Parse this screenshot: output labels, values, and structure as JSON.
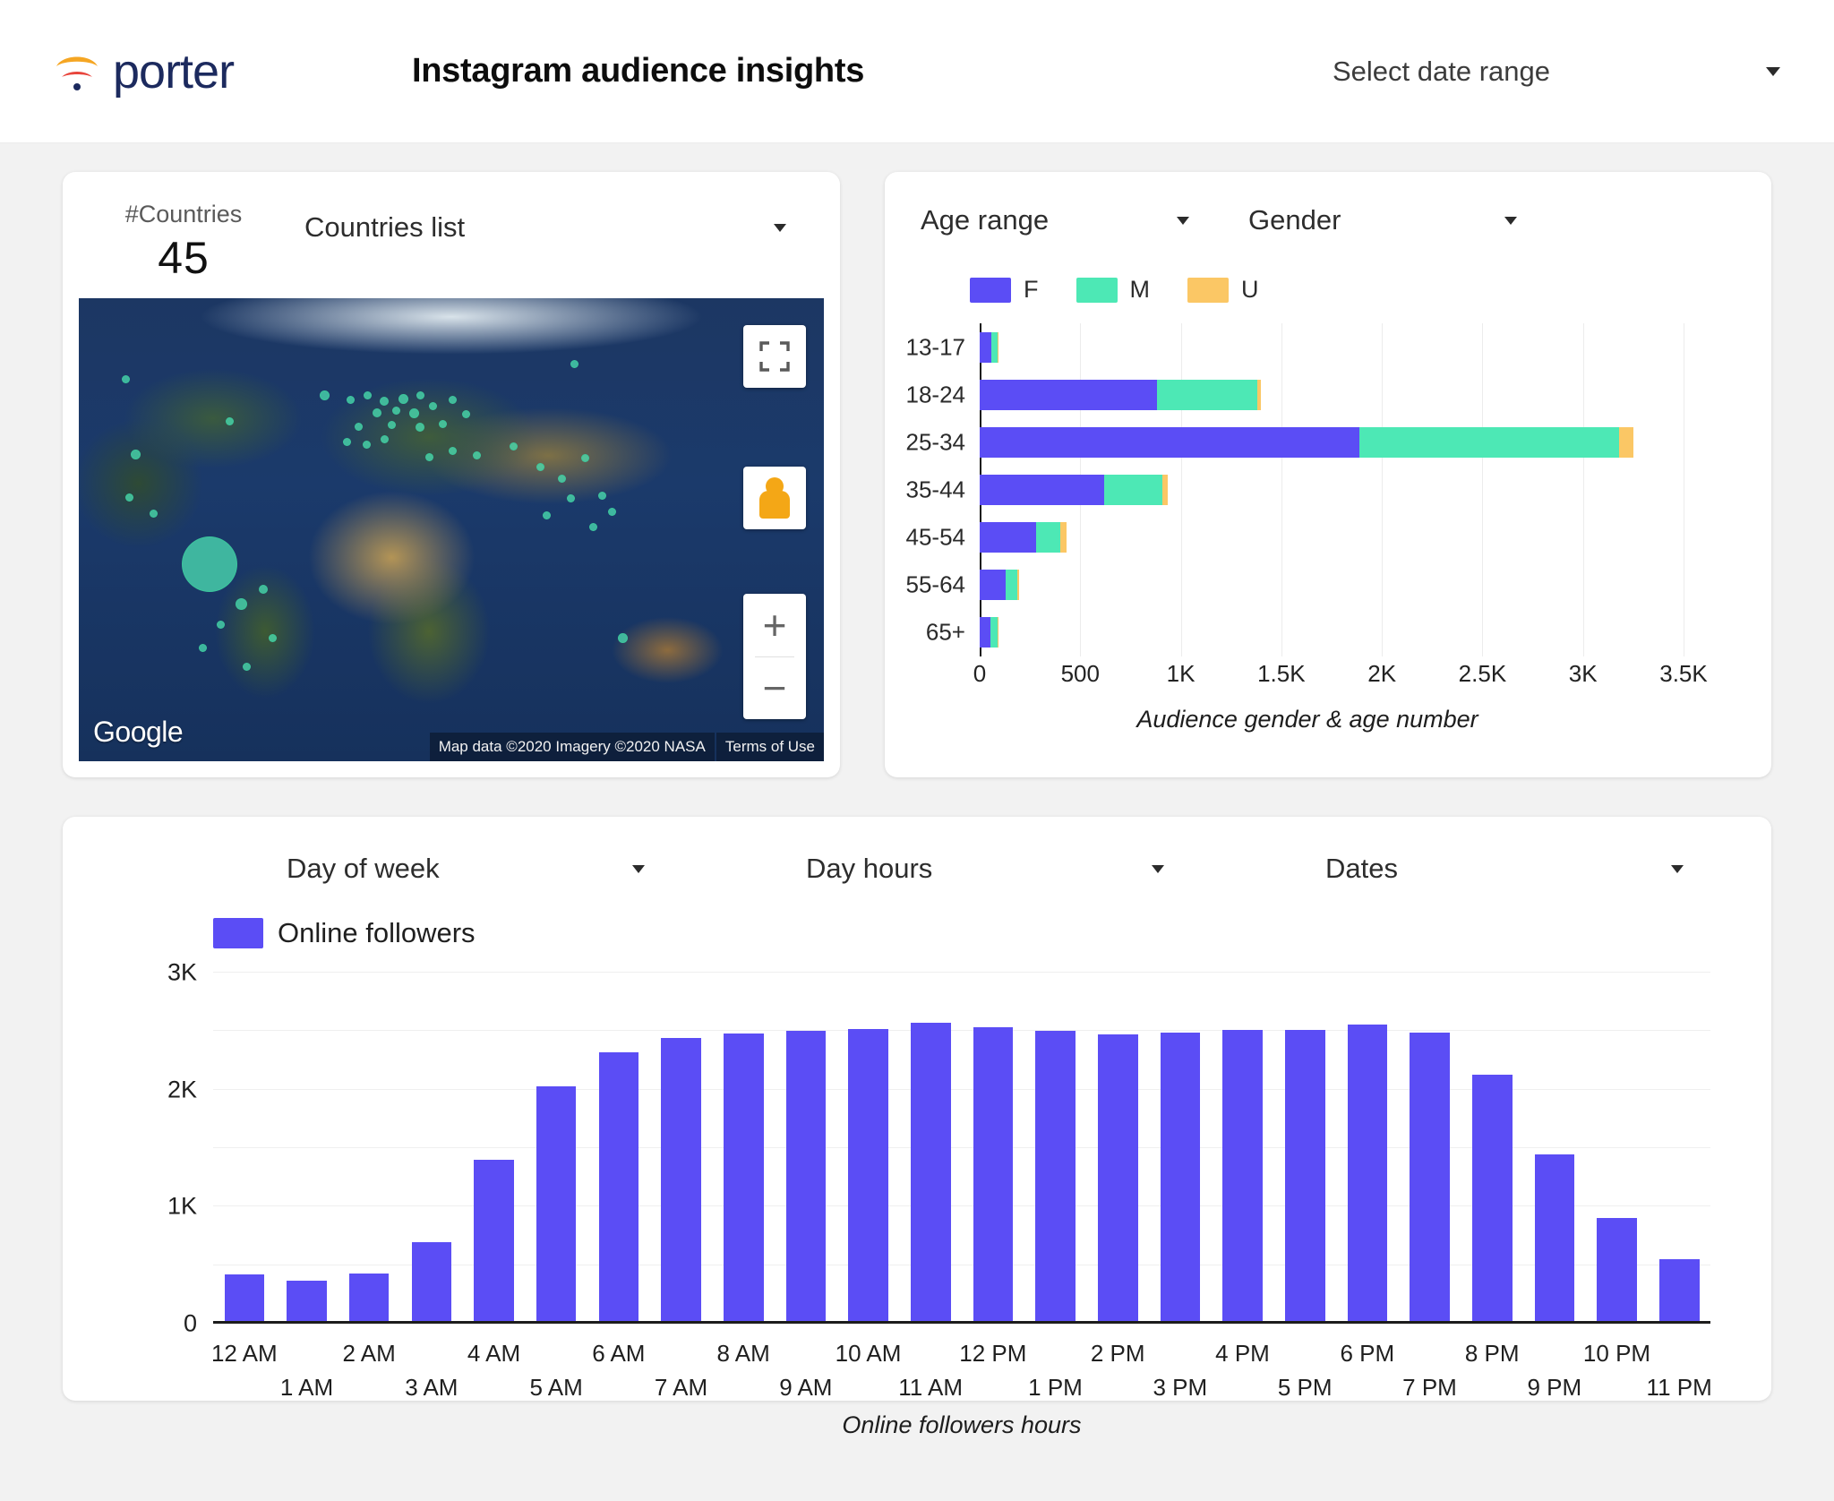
{
  "header": {
    "brand_name": "porter",
    "brand_colors": {
      "arc_top": "#F5A623",
      "arc_bottom": "#E8453C",
      "word": "#1C2A5E"
    },
    "title": "Instagram audience insights",
    "date_range_label": "Select date range"
  },
  "countries_card": {
    "kpi_label": "#Countries",
    "kpi_value": "45",
    "dropdown_label": "Countries list",
    "map": {
      "watermark": "Google",
      "attribution": "Map data ©2020 Imagery ©2020 NASA",
      "terms": "Terms of Use",
      "zoom_in": "+",
      "zoom_out": "−"
    }
  },
  "gender_card": {
    "dropdown_age_label": "Age range",
    "dropdown_gender_label": "Gender",
    "chart_data": {
      "type": "bar",
      "orientation": "horizontal",
      "stacked": true,
      "title": "",
      "xlabel": "Audience gender & age number",
      "ylabel": "",
      "categories": [
        "13-17",
        "18-24",
        "25-34",
        "35-44",
        "45-54",
        "55-64",
        "65+"
      ],
      "series": [
        {
          "name": "F",
          "color": "#5B4DF5",
          "values": [
            60,
            880,
            1890,
            620,
            280,
            130,
            55
          ]
        },
        {
          "name": "M",
          "color": "#4DE8B5",
          "values": [
            30,
            500,
            1290,
            290,
            120,
            55,
            35
          ]
        },
        {
          "name": "U",
          "color": "#FBC765",
          "values": [
            4,
            20,
            70,
            25,
            30,
            10,
            4
          ]
        }
      ],
      "legend": [
        "F",
        "M",
        "U"
      ],
      "legend_position": "top-left",
      "xlim": [
        0,
        3500
      ],
      "xticks": [
        0,
        500,
        1000,
        1500,
        2000,
        2500,
        3000,
        3500
      ],
      "xticklabels": [
        "0",
        "500",
        "1K",
        "1.5K",
        "2K",
        "2.5K",
        "3K",
        "3.5K"
      ],
      "grid": true
    }
  },
  "hours_card": {
    "dropdown_day_label": "Day of week",
    "dropdown_hours_label": "Day hours",
    "dropdown_dates_label": "Dates",
    "legend_label": "Online followers",
    "chart_data": {
      "type": "bar",
      "orientation": "vertical",
      "title": "",
      "xlabel": "Online followers hours",
      "ylabel": "",
      "legend": [
        "Online followers"
      ],
      "series_color": "#5B4DF5",
      "categories": [
        "12 AM",
        "1 AM",
        "2 AM",
        "3 AM",
        "4 AM",
        "5 AM",
        "6 AM",
        "7 AM",
        "8 AM",
        "9 AM",
        "10 AM",
        "11 AM",
        "12 PM",
        "1 PM",
        "2 PM",
        "3 PM",
        "4 PM",
        "5 PM",
        "6 PM",
        "7 PM",
        "8 PM",
        "9 PM",
        "10 PM",
        "11 PM"
      ],
      "values": [
        420,
        370,
        430,
        700,
        1400,
        2030,
        2320,
        2440,
        2480,
        2500,
        2520,
        2570,
        2530,
        2500,
        2470,
        2490,
        2510,
        2510,
        2560,
        2490,
        2130,
        1450,
        900,
        550
      ],
      "ylim": [
        0,
        3000
      ],
      "yticks": [
        0,
        1000,
        2000,
        3000
      ],
      "yticklabels": [
        "0",
        "1K",
        "2K",
        "3K"
      ],
      "grid": true
    }
  }
}
